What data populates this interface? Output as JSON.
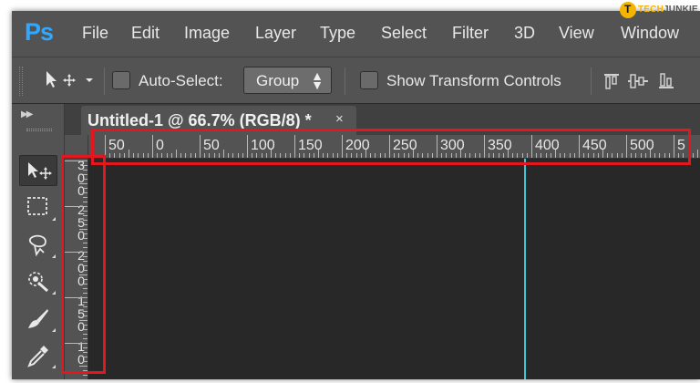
{
  "app": {
    "logo": "Ps",
    "accent_color": "#31a8ff"
  },
  "menu": {
    "items": [
      "File",
      "Edit",
      "Image",
      "Layer",
      "Type",
      "Select",
      "Filter",
      "3D",
      "View",
      "Window"
    ]
  },
  "options_bar": {
    "tool_preset_icon": "move-tool-icon",
    "auto_select_label": "Auto-Select:",
    "auto_select_checked": false,
    "auto_select_target": "Group",
    "show_transform_label": "Show Transform Controls",
    "show_transform_checked": false
  },
  "tools": [
    {
      "icon": "move-tool-icon",
      "active": true
    },
    {
      "icon": "marquee-tool-icon",
      "active": false
    },
    {
      "icon": "lasso-tool-icon",
      "active": false
    },
    {
      "icon": "quick-selection-tool-icon",
      "active": false
    },
    {
      "icon": "pen-tool-icon",
      "active": false
    },
    {
      "icon": "eyedropper-tool-icon",
      "active": false
    }
  ],
  "document": {
    "tab_title": "Untitled-1 @ 66.7% (RGB/8) *",
    "close_glyph": "×"
  },
  "rulers": {
    "horizontal_labels": [
      "50",
      "0",
      "50",
      "100",
      "150",
      "200",
      "250",
      "300",
      "350",
      "400",
      "450",
      "500",
      "5"
    ],
    "vertical_labels": [
      [
        "3",
        "0",
        "0"
      ],
      [
        "2",
        "5",
        "0"
      ],
      [
        "2",
        "0",
        "0"
      ],
      [
        "1",
        "5",
        "0"
      ],
      [
        "1",
        "0"
      ]
    ],
    "guide_color": "#3cc7d9",
    "highlight_color": "#e4161e"
  },
  "watermark": {
    "mark": "T",
    "part1": "TECH",
    "part2": "JUNKIE"
  }
}
